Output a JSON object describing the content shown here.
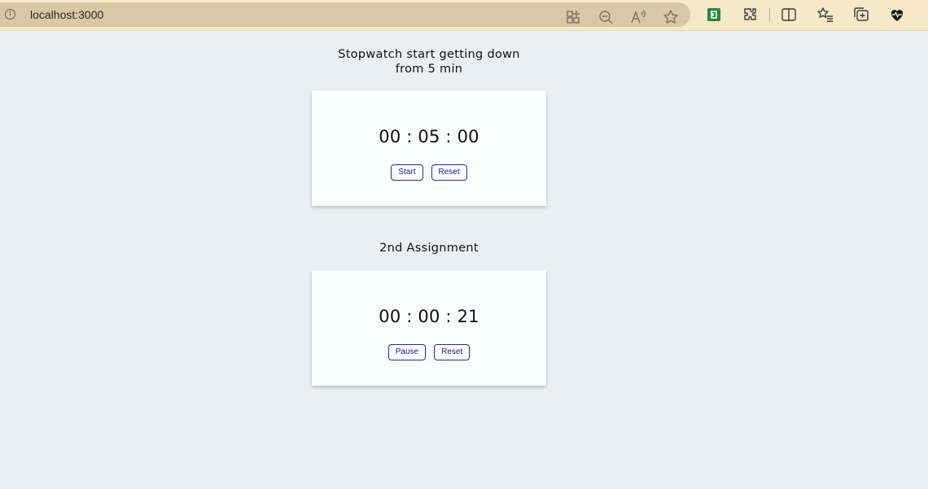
{
  "browser": {
    "url": "localhost:3000",
    "icons": [
      "info-icon",
      "grid-add-icon",
      "zoom-out-icon",
      "read-aloud-icon",
      "favorite-star-icon",
      "green-extension-icon",
      "puzzle-extensions-icon",
      "split-screen-icon",
      "favorites-list-icon",
      "collections-icon",
      "browser-health-icon"
    ]
  },
  "stopwatch_section": {
    "title_line1": "Stopwatch start getting down",
    "title_line2": "from 5 min",
    "time": "00 : 05 : 00",
    "start_label": "Start",
    "reset_label": "Reset"
  },
  "assignment_section": {
    "title": "2nd Assignment",
    "time": "00 : 00 : 21",
    "pause_label": "Pause",
    "reset_label": "Reset"
  },
  "colors": {
    "page_bg": "#ebeef2",
    "card_bg": "#fbfefc",
    "button_border": "#2222cc",
    "toolbar_bg": "#f5e9c8"
  }
}
